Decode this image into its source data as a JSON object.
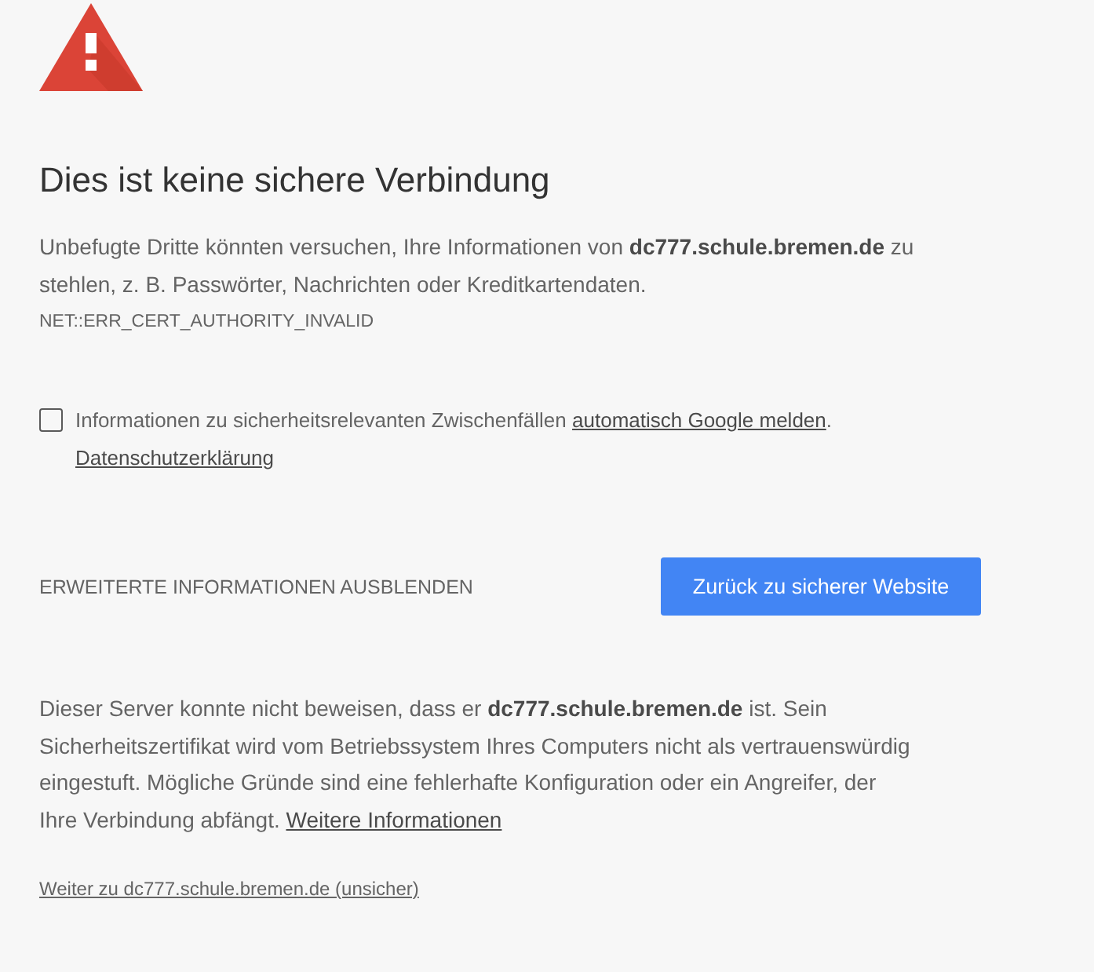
{
  "title": "Dies ist keine sichere Verbindung",
  "summary": "Unbefugte Dritte könnten versuchen, Ihre Informationen von **dc777.schule.bremen.de** zu stehlen, z. B. Passwörter, Nachrichten oder Kreditkartendaten.",
  "error_code": "NET::ERR_CERT_AUTHORITY_INVALID",
  "report": {
    "checked": false,
    "text": "Informationen zu sicherheitsrelevanten Zwischenfällen",
    "link": "automatisch Google melden",
    "suffix": ".",
    "privacy_link": "Datenschutzerklärung"
  },
  "advanced_button": "ERWEITERTE INFORMATIONEN AUSBLENDEN",
  "primary_button": "Zurück zu sicherer Website",
  "details": {
    "text": "Dieser Server konnte nicht beweisen, dass er **dc777.schule.bremen.de** ist. Sein Sicherheitszertifikat wird vom Betriebssystem Ihres Computers nicht als vertrauenswürdig eingestuft. Mögliche Gründe sind eine fehlerhafte Konfiguration oder ein Angreifer, der Ihre Verbindung abfängt.",
    "link": "Weitere Informationen"
  },
  "proceed_link": "Weiter zu dc777.schule.bremen.de (unsicher)"
}
